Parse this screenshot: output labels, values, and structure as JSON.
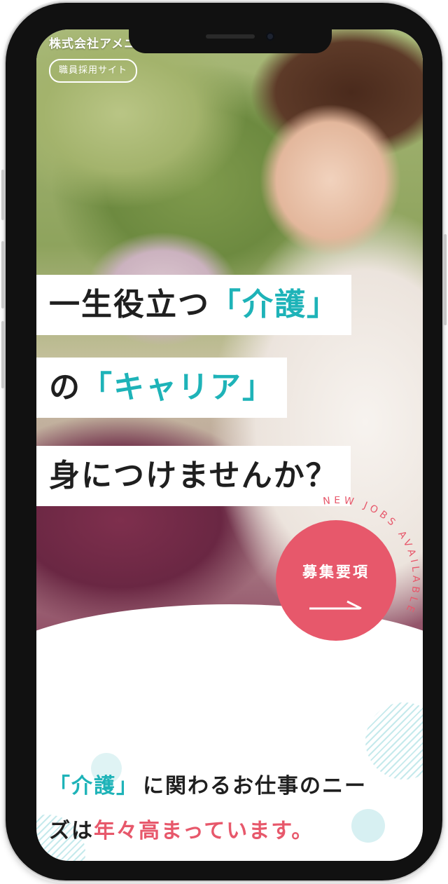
{
  "header": {
    "company_name": "株式会社アメニ",
    "site_label": "職員採用サイト"
  },
  "hero": {
    "line1": {
      "text": "一生役立つ",
      "accent": "「介護」"
    },
    "line2": {
      "text": "の",
      "accent": "「キャリア」"
    },
    "line3": {
      "text": "身につけませんか？"
    }
  },
  "recruit_button": {
    "label": "募集要項",
    "ring_text": "NEW JOBS AVAILABLE",
    "icon": "arrow-right-icon"
  },
  "intro": {
    "line1_accent": "「介護」",
    "line1_text": "に関わるお仕事のニー",
    "line2_text": "ズは",
    "line2_highlight": "年々高まっています。"
  },
  "colors": {
    "accent_teal": "#1eb3b8",
    "accent_pink": "#e7586b",
    "text_dark": "#1f1f1f"
  }
}
